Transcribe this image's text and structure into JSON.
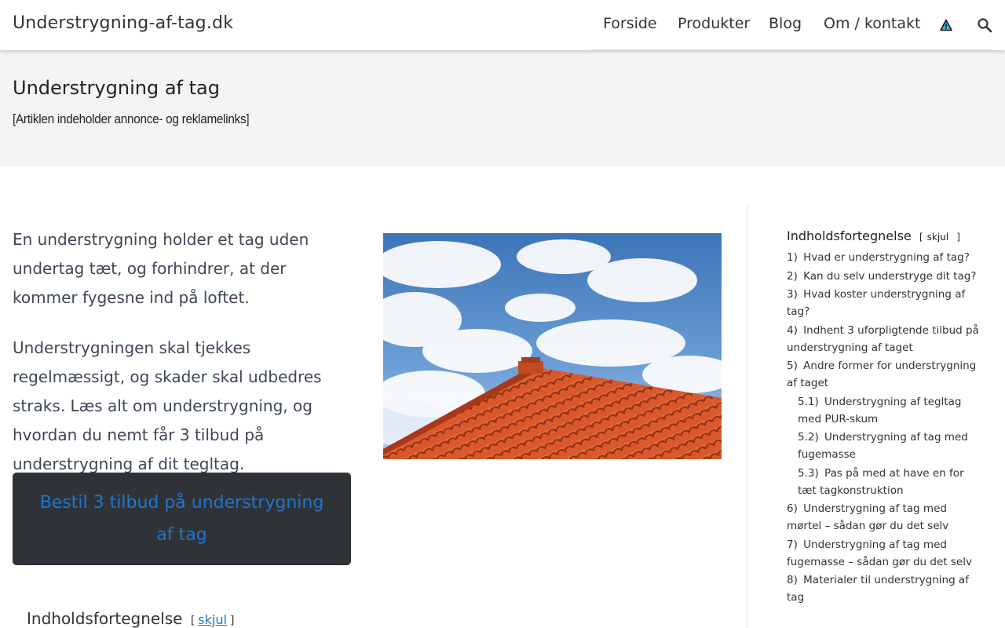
{
  "header": {
    "site_title": "Understrygning-af-tag.dk",
    "nav": [
      "Forside",
      "Produkter",
      "Blog",
      "Om / kontakt"
    ],
    "icons": [
      "warning-triangle-icon",
      "search-icon"
    ]
  },
  "hero": {
    "title": "Understrygning af tag",
    "disclaimer": "[Artiklen indeholder annonce- og reklamelinks]"
  },
  "main": {
    "intro_paragraphs": [
      "En understrygning holder et tag uden undertag tæt, og forhindrer, at der kommer fygesne ind på loftet.",
      "Understrygningen skal tjekkes regelmæssigt, og skader skal udbedres straks. Læs alt om understrygning, og hvordan du nemt får 3 tilbud på understrygning af dit tegltag."
    ],
    "cta_label": "Bestil 3 tilbud på understrygning af tag",
    "toc_title": "Indholdsfortegnelse",
    "toc_toggle": "skjul"
  },
  "sidebar": {
    "toc_title": "Indholdsfortegnelse",
    "toc_toggle": "skjul",
    "items": [
      {
        "num": "1)",
        "label": "Hvad er understrygning af tag?"
      },
      {
        "num": "2)",
        "label": "Kan du selv understryge dit tag?"
      },
      {
        "num": "3)",
        "label": "Hvad koster understrygning af tag?"
      },
      {
        "num": "4)",
        "label": "Indhent 3 uforpligtende tilbud på understrygning af taget"
      },
      {
        "num": "5)",
        "label": "Andre former for understrygning af taget"
      },
      {
        "num": "5.1)",
        "label": "Understrygning af tegltag med PUR-skum"
      },
      {
        "num": "5.2)",
        "label": "Understrygning af tag med fugemasse"
      },
      {
        "num": "5.3)",
        "label": "Pas på med at have en for tæt tagkonstruktion"
      },
      {
        "num": "6)",
        "label": "Understrygning af tag med mørtel – sådan gør du det selv"
      },
      {
        "num": "7)",
        "label": "Understrygning af tag med fugemasse – sådan gør du det selv"
      },
      {
        "num": "8)",
        "label": "Materialer til understrygning af tag"
      }
    ]
  },
  "colors": {
    "link": "#1f77d0",
    "cta_bg": "#2f3338",
    "hero_bg": "#f4f4f4"
  }
}
